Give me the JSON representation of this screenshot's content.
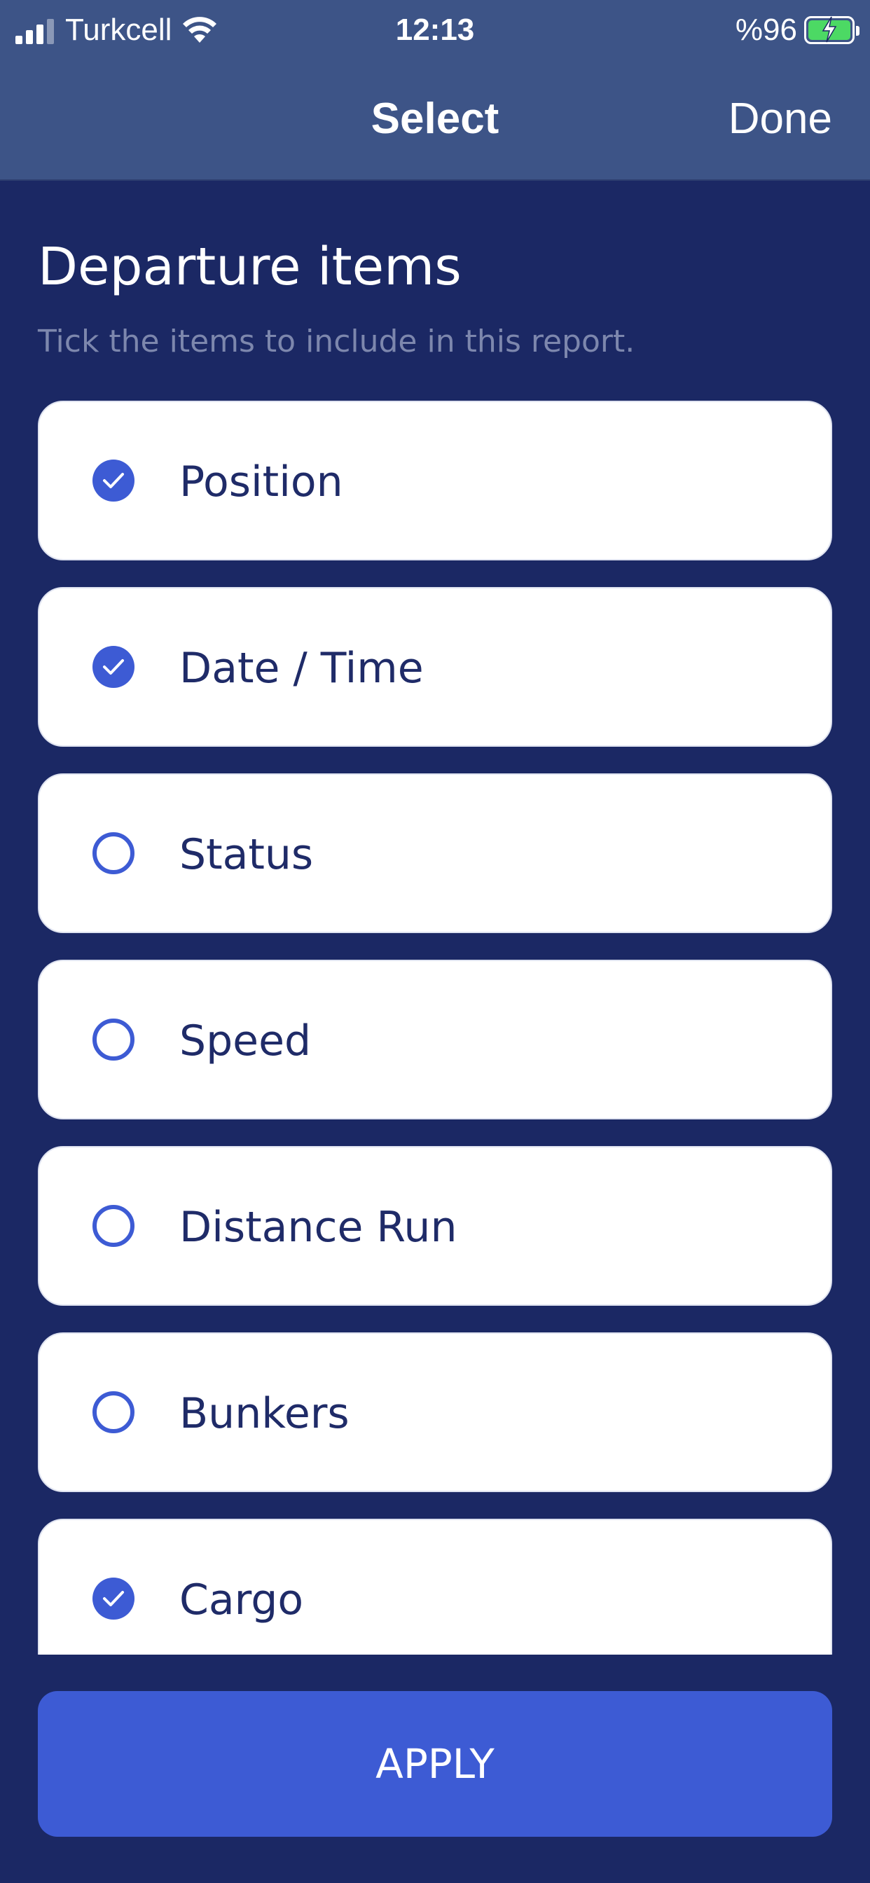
{
  "status_bar": {
    "carrier": "Turkcell",
    "time": "12:13",
    "battery_text": "%96",
    "battery_color": "#4cd964"
  },
  "nav": {
    "title": "Select",
    "done_label": "Done"
  },
  "section": {
    "title": "Departure items",
    "subtitle": "Tick the items to include in this report."
  },
  "items": [
    {
      "label": "Position",
      "checked": true
    },
    {
      "label": "Date / Time",
      "checked": true
    },
    {
      "label": "Status",
      "checked": false
    },
    {
      "label": "Speed",
      "checked": false
    },
    {
      "label": "Distance Run",
      "checked": false
    },
    {
      "label": "Bunkers",
      "checked": false
    },
    {
      "label": "Cargo",
      "checked": true
    }
  ],
  "apply_label": "APPLY",
  "colors": {
    "background": "#1b2864",
    "header": "#3d5487",
    "accent": "#3d5bd4"
  }
}
